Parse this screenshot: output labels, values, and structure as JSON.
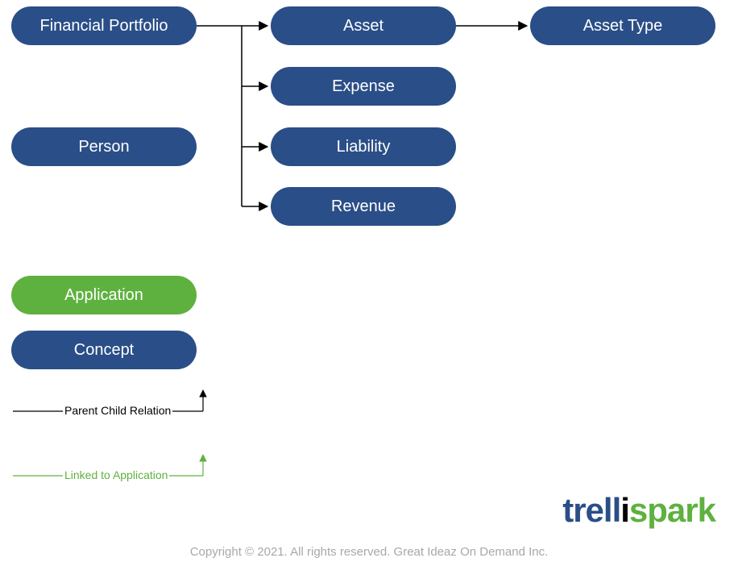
{
  "nodes": {
    "financial_portfolio": "Financial Portfolio",
    "asset": "Asset",
    "asset_type": "Asset Type",
    "expense": "Expense",
    "person": "Person",
    "liability": "Liability",
    "revenue": "Revenue",
    "application": "Application",
    "concept": "Concept"
  },
  "legend": {
    "parent_child": "Parent Child Relation",
    "linked": "Linked to Application"
  },
  "logo": {
    "p1": "trell",
    "p2": "i",
    "p3": "spark"
  },
  "footer": "Copyright © 2021. All rights reserved. Great Ideaz On Demand Inc.",
  "colors": {
    "blue": "#2a4e87",
    "green": "#5eb13f",
    "black": "#000000"
  }
}
